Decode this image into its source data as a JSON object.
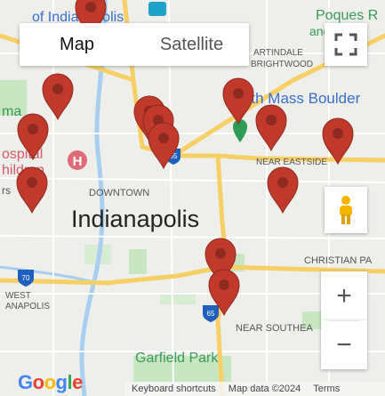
{
  "map_type": {
    "map_label": "Map",
    "satellite_label": "Satellite",
    "selected": "Map"
  },
  "labels": {
    "city": "Indianapolis",
    "downtown": "DOWNTOWN",
    "near_mass": "North Mass Boulder",
    "near_eastside": "NEAR EASTSIDE",
    "christian_park": "CHRISTIAN PA",
    "near_southeast": "NEAR SOUTHEA",
    "garfield_park": "Garfield Park",
    "poques": "Poques R",
    "and_oude": "and oude",
    "artindale": "ARTINDALE",
    "brightwood": "BRIGHTWOOD",
    "west_indy_1": "WEST",
    "west_indy_2": "ANAPOLIS",
    "hospital_1": "ospital",
    "hospital_2": "hildren",
    "top_left": "of Indianapolis",
    "partial_ma": "ma",
    "partial_rs": "rs",
    "i70": "70",
    "i65a": "65",
    "i65b": "65"
  },
  "controls": {
    "fullscreen": "fullscreen-icon",
    "pegman": "pegman-icon",
    "zoom_in": "+",
    "zoom_out": "−"
  },
  "footer": {
    "logo": "Google",
    "keyboard": "Keyboard shortcuts",
    "map_data": "Map data ©2024",
    "terms": "Terms"
  },
  "colors": {
    "marker": "#c0392b",
    "marker_dark": "#8e2a20",
    "highway": "#f6cf65",
    "park": "#c7e6c1",
    "water": "#a8cff0"
  }
}
